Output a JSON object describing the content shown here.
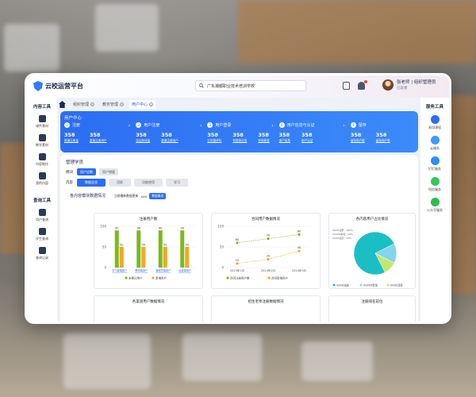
{
  "app": {
    "title": "云校运营平台"
  },
  "search": {
    "placeholder": "广东潮都职业技术培训学校"
  },
  "user": {
    "name": "张老师 | 组织管理员",
    "status": "已就绪"
  },
  "left_sidebar": {
    "content_title": "内容工具",
    "content_items": [
      {
        "label": "课件素材",
        "icon": "megaphone-icon"
      },
      {
        "label": "教学素材",
        "icon": "book-icon"
      },
      {
        "label": "内容制作",
        "icon": "edit-icon"
      },
      {
        "label": "我的内容",
        "icon": "folder-icon"
      }
    ],
    "query_title": "查询工具",
    "query_items": [
      {
        "label": "用户查询",
        "icon": "user-icon"
      },
      {
        "label": "学生查询",
        "icon": "student-icon"
      },
      {
        "label": "查询记录",
        "icon": "record-icon"
      }
    ]
  },
  "right_sidebar": {
    "title": "服务工具",
    "items": [
      {
        "label": "易用课程",
        "icon": "c-logo-icon",
        "color": "#2c6df2"
      },
      {
        "label": "云服务",
        "icon": "cloud-icon",
        "color": "#3b9bff"
      },
      {
        "label": "钉钉服务",
        "icon": "dingtalk-icon",
        "color": "#2f8cf8"
      },
      {
        "label": "短信服务",
        "icon": "message-icon",
        "color": "#34c759"
      },
      {
        "label": "公众号服务",
        "icon": "wechat-icon",
        "color": "#2bbd4e"
      }
    ]
  },
  "tabs": [
    {
      "label": "组织管理"
    },
    {
      "label": "教务管理"
    },
    {
      "label": "用户中心",
      "active": true
    }
  ],
  "banner": {
    "title": "用户中心",
    "steps": [
      {
        "num": "1",
        "title": "注册",
        "values": [
          {
            "n": "358",
            "l": "渠道注册量"
          },
          {
            "n": "358",
            "l": "直接注册用户"
          }
        ]
      },
      {
        "num": "2",
        "title": "用户注册",
        "values": [
          {
            "n": "358",
            "l": "自注册流量"
          },
          {
            "n": "358",
            "l": "渠道注册用户"
          }
        ]
      },
      {
        "num": "3",
        "title": "用户登录",
        "values": [
          {
            "n": "358",
            "l": "已完善资料"
          },
          {
            "n": "358",
            "l": "有登录记录"
          },
          {
            "n": "358",
            "l": "完成登录"
          }
        ]
      },
      {
        "num": "4",
        "title": "用户信息与认证",
        "values": [
          {
            "n": "358",
            "l": "用户信息"
          },
          {
            "n": "358",
            "l": "用户认证"
          }
        ]
      },
      {
        "num": "5",
        "title": "留存",
        "values": [
          {
            "n": "358",
            "l": "留存用户数"
          },
          {
            "n": "358",
            "l": "留存用户率"
          }
        ]
      }
    ]
  },
  "filters": {
    "panel_title": "管理学员",
    "row1_label": "模块",
    "row1": [
      {
        "label": "用户总数",
        "on": true
      },
      {
        "label": "用户增量",
        "on": false
      }
    ],
    "row2_label": "内容",
    "row2": [
      {
        "label": "数据总览",
        "on": true
      },
      {
        "label": "活跃",
        "on": false
      },
      {
        "label": "功能使用",
        "on": false
      },
      {
        "label": "学习",
        "on": false
      }
    ]
  },
  "section": {
    "title": "各内容模块数据情况",
    "ctrl_label": "当前最新数据更新",
    "ctrl_value": "XXX",
    "ctrl_button": "数据概览"
  },
  "chart_data": [
    {
      "type": "bar",
      "title": "注册用户数",
      "categories": [
        "学习者端用户",
        "教师端用户",
        "管理员端用户",
        "运营端用户"
      ],
      "series": [
        {
          "name": "未登记用户",
          "values": [
            90,
            90,
            90,
            90
          ],
          "color": "#7cba1a"
        },
        {
          "name": "新增用户",
          "values": [
            50,
            50,
            50,
            50
          ],
          "color": "#f5a623"
        }
      ],
      "data_labels": [
        "90",
        "50"
      ],
      "ylim": [
        0,
        100
      ],
      "yticks": [
        "100",
        "50",
        "0"
      ]
    },
    {
      "type": "line",
      "title": "合同用户数据情况",
      "x": [
        "2024年1月",
        "2024年2月",
        "2024年3月"
      ],
      "series": [
        {
          "name": "合同注册用户数",
          "values": [
            60,
            70,
            80
          ],
          "color": "#7cba1a"
        },
        {
          "name": "合同新增用户",
          "values": [
            10,
            20,
            40
          ],
          "color": "#f5a623"
        }
      ],
      "yticks": [
        "100",
        "50",
        "0"
      ],
      "ylim": [
        0,
        100
      ]
    },
    {
      "type": "pie",
      "title": "各内容用户占比情况",
      "slices": [
        {
          "name": "XXXX注册",
          "value": 75,
          "color": "#1abfc4"
        },
        {
          "name": "XXXXX新增",
          "value": 15,
          "color": "#86d3f0"
        },
        {
          "name": "XXXX活跃",
          "value": 10,
          "color": "#c4e86a"
        }
      ],
      "labels": [
        "XXXX注册：100%",
        "XXXXX新增：18%",
        "XXXX活跃：12%"
      ]
    },
    {
      "type": "bar",
      "title": "各渠道用户数据情况",
      "categories": [],
      "series": []
    },
    {
      "type": "bar",
      "title": "招生老师注册数据情况",
      "categories": [],
      "series": []
    },
    {
      "type": "bar",
      "title": "注册排名前位",
      "categories": [],
      "series": []
    }
  ]
}
